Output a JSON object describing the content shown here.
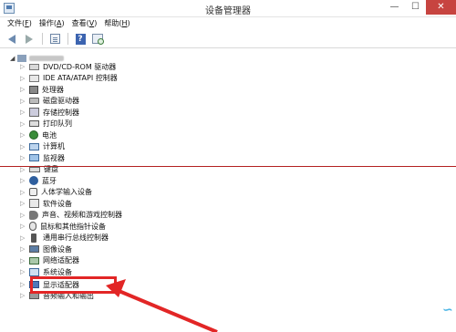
{
  "window": {
    "title": "设备管理器",
    "minimize": "—",
    "maximize": "☐",
    "close": "✕"
  },
  "menu": [
    {
      "label": "文件",
      "key": "F"
    },
    {
      "label": "操作",
      "key": "A"
    },
    {
      "label": "查看",
      "key": "V"
    },
    {
      "label": "帮助",
      "key": "H"
    }
  ],
  "toolbar": {
    "help_glyph": "?"
  },
  "tree": {
    "nodes": [
      {
        "label": "DVD/CD-ROM 驱动器",
        "icon": "dvd-drive-icon"
      },
      {
        "label": "IDE ATA/ATAPI 控制器",
        "icon": "ide-controller-icon"
      },
      {
        "label": "处理器",
        "icon": "processor-icon"
      },
      {
        "label": "磁盘驱动器",
        "icon": "disk-drive-icon"
      },
      {
        "label": "存储控制器",
        "icon": "storage-controller-icon"
      },
      {
        "label": "打印队列",
        "icon": "printer-icon"
      },
      {
        "label": "电池",
        "icon": "battery-icon"
      },
      {
        "label": "计算机",
        "icon": "computer-icon"
      },
      {
        "label": "监视器",
        "icon": "monitor-icon"
      },
      {
        "label": "键盘",
        "icon": "keyboard-icon"
      },
      {
        "label": "蓝牙",
        "icon": "bluetooth-icon"
      },
      {
        "label": "人体学输入设备",
        "icon": "hid-icon"
      },
      {
        "label": "软件设备",
        "icon": "software-device-icon"
      },
      {
        "label": "声音、视频和游戏控制器",
        "icon": "sound-icon"
      },
      {
        "label": "鼠标和其他指针设备",
        "icon": "mouse-icon"
      },
      {
        "label": "通用串行总线控制器",
        "icon": "usb-icon"
      },
      {
        "label": "图像设备",
        "icon": "imaging-device-icon"
      },
      {
        "label": "网络适配器",
        "icon": "network-adapter-icon"
      },
      {
        "label": "系统设备",
        "icon": "system-device-icon"
      },
      {
        "label": "显示适配器",
        "icon": "display-adapter-icon"
      },
      {
        "label": "音频输入和输出",
        "icon": "audio-io-icon"
      }
    ]
  },
  "colors": {
    "annotation_red": "#e22626",
    "window_close": "#c74440"
  },
  "expand_glyph": "▷",
  "root_glyph": "◢",
  "corner_glyph": "∽"
}
